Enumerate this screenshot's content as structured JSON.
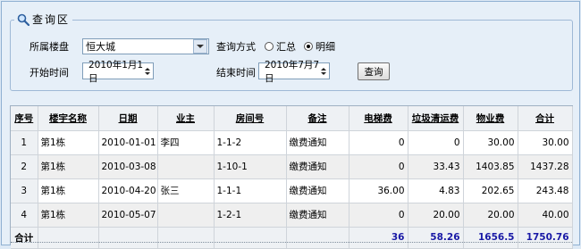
{
  "query_panel": {
    "title": "查询区",
    "building_label": "所属楼盘",
    "building_value": "恒大城",
    "mode_label": "查询方式",
    "mode_options": [
      "汇总",
      "明细"
    ],
    "mode_selected": "明细",
    "start_label": "开始时间",
    "start_value": "2010年1月1日",
    "end_label": "结束时间",
    "end_value": "2010年7月7日",
    "query_button": "查询"
  },
  "grid": {
    "columns": [
      "序号",
      "楼宇名称",
      "日期",
      "业主",
      "房间号",
      "备注",
      "电梯费",
      "垃圾清运费",
      "物业费",
      "合计"
    ],
    "rows": [
      [
        "1",
        "第1栋",
        "2010-01-01",
        "李四",
        "1-1-2",
        "缴费通知",
        "0",
        "0",
        "30.00",
        "30.00"
      ],
      [
        "2",
        "第1栋",
        "2010-03-08",
        "",
        "1-10-1",
        "缴费通知",
        "0",
        "33.43",
        "1403.85",
        "1437.28"
      ],
      [
        "3",
        "第1栋",
        "2010-04-20",
        "张三",
        "1-1-1",
        "缴费通知",
        "36.00",
        "4.83",
        "202.65",
        "243.48"
      ],
      [
        "4",
        "第1栋",
        "2010-05-07",
        "",
        "1-2-1",
        "缴费通知",
        "0",
        "20.00",
        "20.00",
        "40.00"
      ]
    ],
    "total": [
      "合计",
      "",
      "",
      "",
      "",
      "",
      "36",
      "58.26",
      "1656.5",
      "1750.76"
    ]
  }
}
